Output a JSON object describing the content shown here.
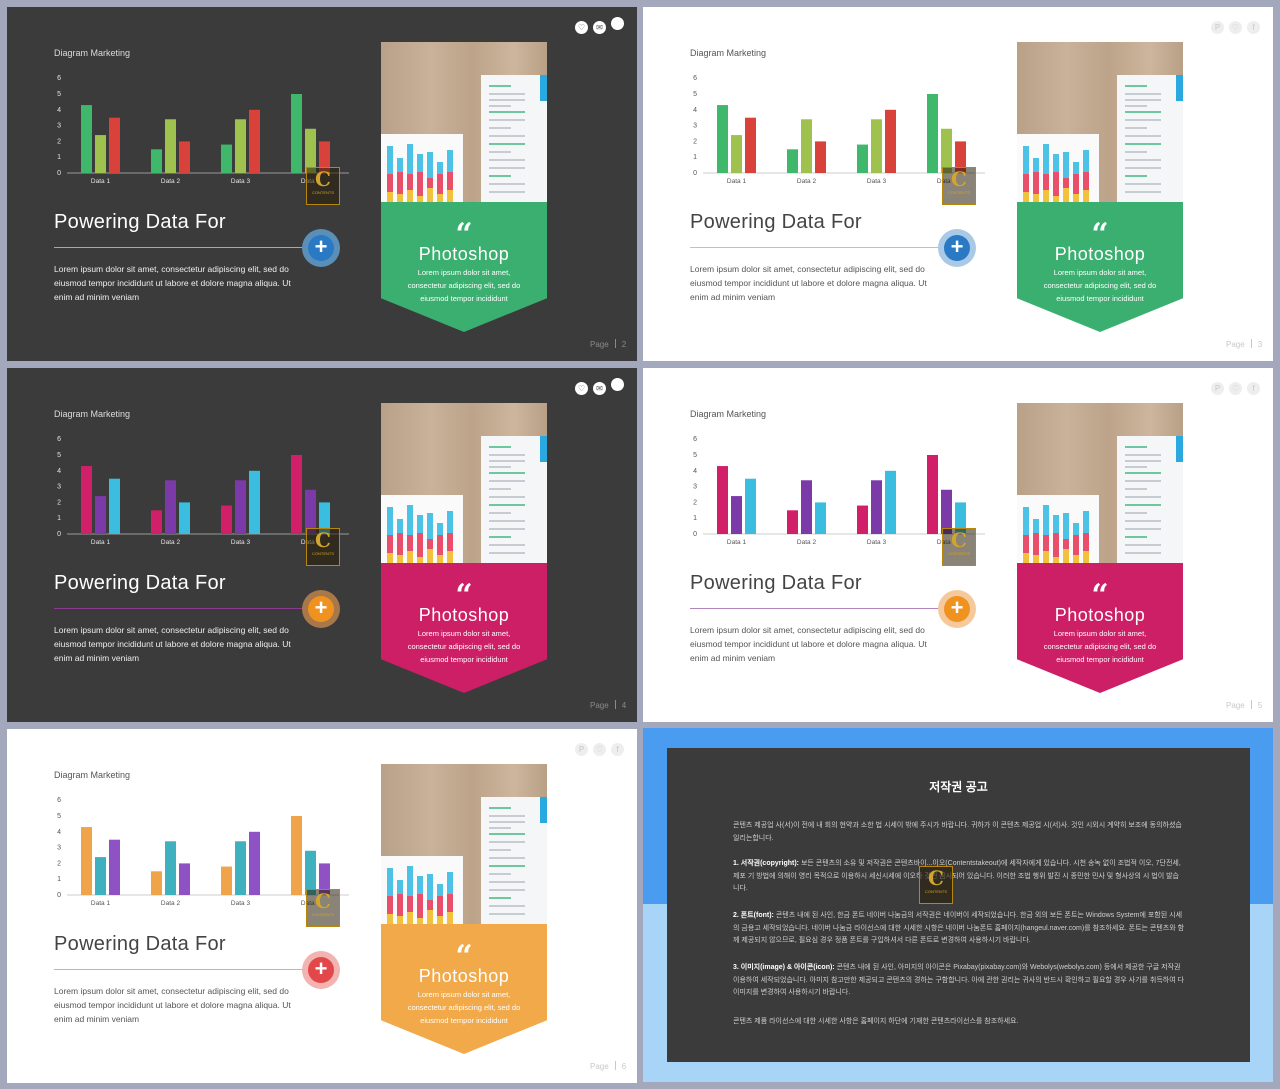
{
  "slides": [
    {
      "theme": "dark",
      "page": "2",
      "colors": [
        "#3fb86b",
        "#9fc24f",
        "#d8423a"
      ],
      "plus_color": "#2a79c4",
      "plus_glow": "#5a8fb8",
      "plus_symbol": "+",
      "line_color": "#b1ad74",
      "banner_color": "#3aaf6f",
      "icons": [
        "♡",
        "✉",
        ""
      ]
    },
    {
      "theme": "light",
      "page": "3",
      "colors": [
        "#3fb86b",
        "#9fc24f",
        "#d8423a"
      ],
      "plus_color": "#2a79c4",
      "plus_glow": "#a9c9e6",
      "plus_symbol": "+",
      "line_color": "#c9c58f",
      "banner_color": "#3aaf6f",
      "icons": [
        "P",
        "♡",
        "f"
      ]
    },
    {
      "theme": "dark",
      "page": "4",
      "colors": [
        "#d21f6a",
        "#7b3aa8",
        "#3bbde0"
      ],
      "plus_color": "#f0921f",
      "plus_glow": "#a8774a",
      "plus_symbol": "+",
      "line_color": "#8c3a8f",
      "banner_color": "#cc1f65",
      "icons": [
        "♡",
        "✉",
        ""
      ]
    },
    {
      "theme": "light",
      "page": "5",
      "colors": [
        "#d21f6a",
        "#7b3aa8",
        "#3bbde0"
      ],
      "plus_color": "#f0921f",
      "plus_glow": "#f6c99d",
      "plus_symbol": "+",
      "line_color": "#b385bd",
      "banner_color": "#cc1f65",
      "icons": [
        "P",
        "♡",
        "f"
      ]
    },
    {
      "theme": "light",
      "page": "6",
      "colors": [
        "#f0a44a",
        "#3fb1be",
        "#8e52c4"
      ],
      "plus_color": "#e2474a",
      "plus_glow": "#f2b4b1",
      "plus_symbol": "+",
      "line_color": "#8ec7cc",
      "banner_color": "#f1a94a",
      "icons": [
        "P",
        "♡",
        "f"
      ]
    }
  ],
  "common": {
    "chart_label": "Diagram  Marketing",
    "heading": "Powering Data For",
    "body": "Lorem ipsum dolor sit amet, consectetur adipiscing elit, sed do eiusmod tempor incididunt ut labore et dolore magna aliqua. Ut enim ad minim veniam",
    "quote_mark": "“",
    "ps_title": "Photoshop",
    "ps_text": "Lorem ipsum dolor sit amet, consectetur adipiscing elit, sed do eiusmod tempor incididunt",
    "page_label": "Page",
    "logo_letter": "C",
    "logo_text": "CONTENTS"
  },
  "chart_data": {
    "type": "bar",
    "categories": [
      "Data 1",
      "Data 2",
      "Data 3",
      "Data 4"
    ],
    "series": [
      {
        "values": [
          4.3,
          1.5,
          1.8,
          5.0
        ]
      },
      {
        "values": [
          2.4,
          3.4,
          3.4,
          2.8
        ]
      },
      {
        "values": [
          3.5,
          2.0,
          4.0,
          2.0
        ]
      }
    ],
    "ylim": [
      0,
      6
    ],
    "yticks": [
      "0",
      "1",
      "2",
      "3",
      "4",
      "5",
      "6"
    ]
  },
  "notice": {
    "title": "저작권 공고",
    "intro": "콘텐츠 제공업 사(서)이 전에 내 회의 현약과 소한 법 시세이 밖에 주시가 바랍니다. 귀하가 이 콘텐츠 제공업 시(서)사. 것인 시외시 계약히 보조에 동의하셨습 일리는합니다.",
    "items": [
      {
        "label": "1. 서작권(copyright):",
        "text": " 보든 콘텐츠의 소유 및 저작권은 콘텐츠바이...이오(Contentstakeout)에 세작자에게 있습니다. 시천 송녹 없이 조법적 이오, 7단전세, 제포 기 방법에 의해이 영리 목적으로 이용하시 세신시세에 이오하 것인 금시되어 있습니다. 이러한 조법 행위 발진 시 종민한 민사 및 형사상의 시 법이 발습니다."
      },
      {
        "label": "2. 폰트(font):",
        "text": " 콘텐츠 내에 된 사인, 한금 폰트 네이버 나눔금의 서작권은 네이버이 세작되었습니다. 한금 외의 보든 폰트는 Windows System에 포함된 시세의 금용고 세작되었습니다. 네이버 나눔금 라이선스에 대한 시세한 시항은 네이버 나눔폰트 홈페이지(hangeul.naver.com)를 참조하세요. 폰트는 콘텐츠와 함께 제공되지 않으므로, 필요심 경우 정품 폰트를 구입하셔서 다른 폰트로 변경하여 사용하시기 바랍니다."
      },
      {
        "label": "3. 이미지(image) & 아이콘(icon):",
        "text": " 콘텐츠 내에 된 사인, 아미지의 아이콘은 Pixabay(pixabay.com)와 Webolys(webolys.com) 등에서 제공한 구글 저작권 이용하여 세작되었습니다. 아미지 참고만한 제공되고 콘텐츠의 경하는 구함합니다. 아에 관한 권리는 귀사의 반드시 확인하고 필요할 경우 사기를 취득하여 다 이미지를 변경하여 사용하시기 바랍니다."
      }
    ],
    "footer": "콘텐츠 제품 라이선스에 대한 시세한 사항은 홈페이지 하단에 기재한 콘텐츠라이선스를 참조하세요."
  }
}
